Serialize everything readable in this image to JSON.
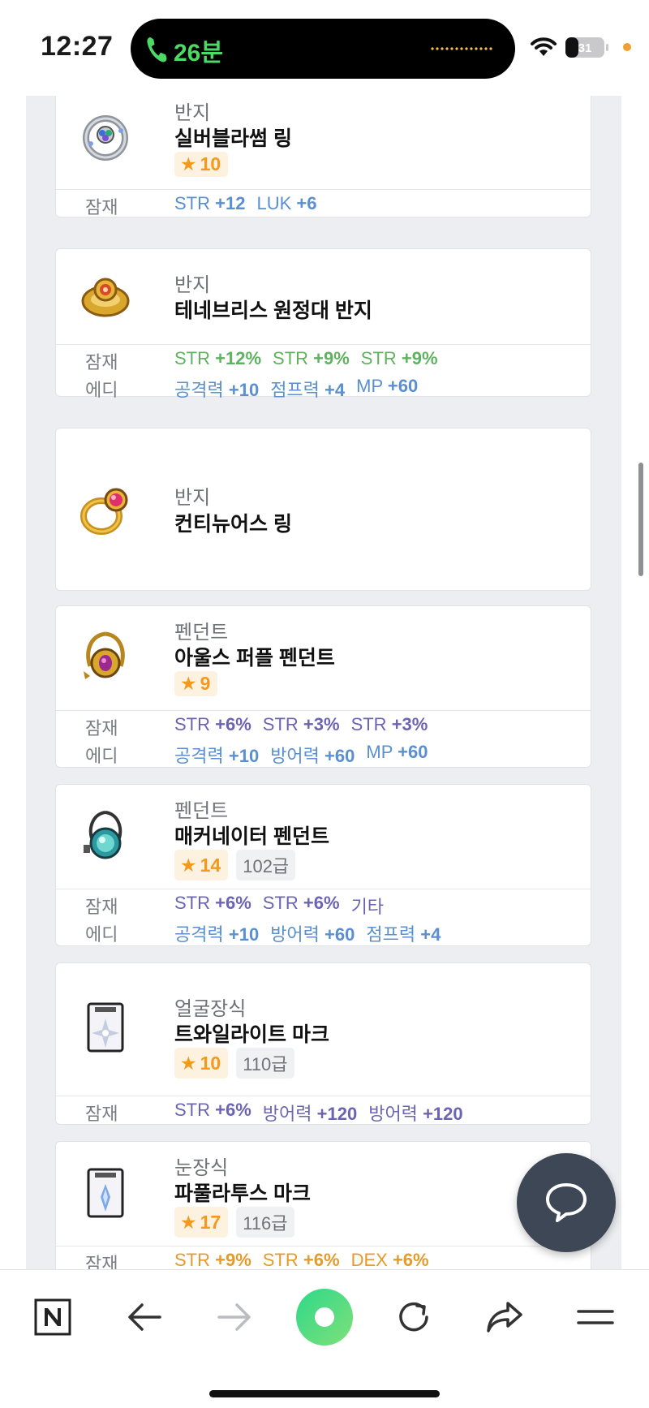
{
  "status_bar": {
    "time": "12:27",
    "call_duration": "26분",
    "battery_level": "31"
  },
  "items": [
    {
      "category": "반지",
      "name": "실버블라썸 링",
      "star": "10",
      "grade": "",
      "icon": "silver-blossom-ring-icon",
      "options": [
        {
          "label": "잠재",
          "color": "blue",
          "values": [
            {
              "stat": "STR",
              "val": "+12"
            },
            {
              "stat": "LUK",
              "val": "+6"
            }
          ]
        }
      ]
    },
    {
      "category": "반지",
      "name": "테네브리스 원정대 반지",
      "star": "",
      "grade": "",
      "icon": "tenebris-ring-icon",
      "options": [
        {
          "label": "잠재",
          "color": "green",
          "values": [
            {
              "stat": "STR",
              "val": "+12%"
            },
            {
              "stat": "STR",
              "val": "+9%"
            },
            {
              "stat": "STR",
              "val": "+9%"
            }
          ]
        },
        {
          "label": "에디",
          "color": "blue",
          "values": [
            {
              "stat": "공격력",
              "val": "+10"
            },
            {
              "stat": "점프력",
              "val": "+4"
            },
            {
              "stat": "MP",
              "val": "+60"
            }
          ]
        }
      ]
    },
    {
      "category": "반지",
      "name": "컨티뉴어스 링",
      "star": "",
      "grade": "",
      "icon": "continuous-ring-icon",
      "options": []
    },
    {
      "category": "펜던트",
      "name": "아울스 퍼플 펜던트",
      "star": "9",
      "grade": "",
      "icon": "purple-pendant-icon",
      "options": [
        {
          "label": "잠재",
          "color": "purple",
          "values": [
            {
              "stat": "STR",
              "val": "+6%"
            },
            {
              "stat": "STR",
              "val": "+3%"
            },
            {
              "stat": "STR",
              "val": "+3%"
            }
          ]
        },
        {
          "label": "에디",
          "color": "blue",
          "values": [
            {
              "stat": "공격력",
              "val": "+10"
            },
            {
              "stat": "방어력",
              "val": "+60"
            },
            {
              "stat": "MP",
              "val": "+60"
            }
          ]
        }
      ]
    },
    {
      "category": "펜던트",
      "name": "매커네이터 펜던트",
      "star": "14",
      "grade": "102급",
      "icon": "mechanator-pendant-icon",
      "options": [
        {
          "label": "잠재",
          "color": "purple",
          "values": [
            {
              "stat": "STR",
              "val": "+6%"
            },
            {
              "stat": "STR",
              "val": "+6%"
            },
            {
              "stat": "기타",
              "val": ""
            }
          ]
        },
        {
          "label": "에디",
          "color": "blue",
          "values": [
            {
              "stat": "공격력",
              "val": "+10"
            },
            {
              "stat": "방어력",
              "val": "+60"
            },
            {
              "stat": "점프력",
              "val": "+4"
            }
          ]
        }
      ]
    },
    {
      "category": "얼굴장식",
      "name": "트와일라이트 마크",
      "star": "10",
      "grade": "110급",
      "icon": "twilight-mark-icon",
      "options": [
        {
          "label": "잠재",
          "color": "purple",
          "values": [
            {
              "stat": "STR",
              "val": "+6%"
            },
            {
              "stat": "방어력",
              "val": "+120"
            },
            {
              "stat": "방어력",
              "val": "+120"
            }
          ]
        }
      ]
    },
    {
      "category": "눈장식",
      "name": "파풀라투스 마크",
      "star": "17",
      "grade": "116급",
      "icon": "papulatus-mark-icon",
      "options": [
        {
          "label": "잠재",
          "color": "orange",
          "values": [
            {
              "stat": "STR",
              "val": "+9%"
            },
            {
              "stat": "STR",
              "val": "+6%"
            },
            {
              "stat": "DEX",
              "val": "+6%"
            }
          ]
        }
      ]
    }
  ],
  "colors": {
    "blue": "#5a8fd1",
    "green": "#5fb25f",
    "purple": "#6b64b4",
    "orange": "#e69a2a",
    "star_bg": "#fdf1df",
    "star_fg": "#f29a1d",
    "chat_fab": "#3d4756",
    "call_green": "#4cd964"
  },
  "bottom_nav": [
    {
      "name": "naver-home-icon"
    },
    {
      "name": "back-arrow-icon"
    },
    {
      "name": "forward-arrow-icon"
    },
    {
      "name": "green-dot-icon"
    },
    {
      "name": "refresh-icon"
    },
    {
      "name": "share-icon"
    },
    {
      "name": "menu-icon"
    }
  ]
}
